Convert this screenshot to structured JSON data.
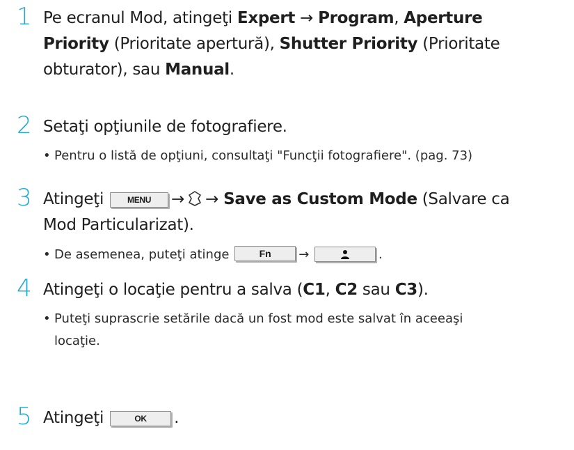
{
  "steps": [
    {
      "number": "1",
      "line1": {
        "t1": "Pe ecranul Mod, atingeţi ",
        "b1": "Expert",
        "t2": " → ",
        "b2": "Program",
        "t3": ", ",
        "b3": "Aperture"
      },
      "line2": {
        "b1": "Priority",
        "t1": " (Prioritate apertură), ",
        "b2": "Shutter Priority",
        "t2": " (Prioritate"
      },
      "line3": {
        "t1": "obturator), sau ",
        "b1": "Manual",
        "t2": "."
      }
    },
    {
      "number": "2",
      "line1": "Setaţi opţiunile de fotografiere.",
      "bullet": "Pentru o listă de opţiuni, consultaţi \"Funcţii fotografiere\". (pag. 73)"
    },
    {
      "number": "3",
      "line1": {
        "t1": "Atingeţi",
        "key": "MENU",
        "t2": "→",
        "t3": "→",
        "b1": "Save as Custom Mode",
        "t4": " (Salvare ca"
      },
      "line2": "Mod Particularizat).",
      "bullet": {
        "t1": "De asemenea, puteţi atinge",
        "key": "Fn",
        "t2": "→",
        "t3": "."
      }
    },
    {
      "number": "4",
      "line1": {
        "t1": "Atingeţi o locaţie pentru a salva (",
        "b1": "C1",
        "t2": ", ",
        "b2": "C2",
        "t3": " sau ",
        "b3": "C3",
        "t4": ")."
      },
      "bullet_line1": "Puteţi suprascrie setările dacă un fost mod este salvat în aceeaşi",
      "bullet_line2": "locaţie."
    },
    {
      "number": "5",
      "line1": {
        "t1": "Atingeţi",
        "key": "OK",
        "t2": "."
      }
    }
  ],
  "bullet_symbol": "•",
  "icons": {
    "custom_mode": "custom-mode-icon",
    "person": "person-icon"
  },
  "colors": {
    "step_number": "#22a9cf",
    "text": "#1f1f1f"
  }
}
